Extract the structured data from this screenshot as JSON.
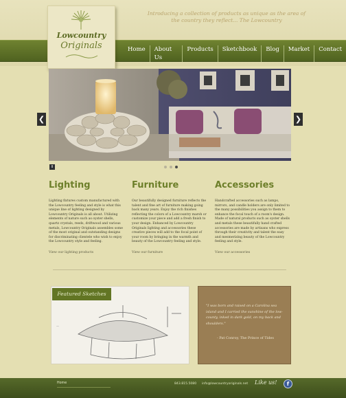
{
  "header": {
    "tagline": "Introducing a collection of products as unique as the area of the country they reflect... The Lowcountry",
    "logo_line1": "Lowcountry",
    "logo_line2": "Originals"
  },
  "nav": {
    "items": [
      "Home",
      "About Us",
      "Products",
      "Sketchbook",
      "Blog",
      "Market",
      "Contact"
    ]
  },
  "slideshow": {
    "prev_label": "❮",
    "next_label": "❯",
    "pause_label": "II",
    "dot_count": 3,
    "active_dot": 2
  },
  "columns": [
    {
      "title": "Lighting",
      "body": "Lighting fixtures custom manufactured with the Lowcountry feeling and style is what this unique line of lighting designed by Lowcountry Originals is all about. Utilizing elements of nature such as oyster shells, quartz crystals, reeds, driftwood and various metals, Lowcountry Originals assembles some of the most original and outstanding designs for discriminating clientele who wish to enjoy the Lowcountry style and feeling.",
      "link": "View our lighting products"
    },
    {
      "title": "Furniture",
      "body": "Our beautifully designed furniture reflects the talent and fine art of furniture making going back many years. Enjoy the rich finishes reflecting the colors of a Lowcountry marsh or customize your piece and add a fresh finish to your design. Enhanced by Lowcountry Originals lighting and accessories these creative pieces will add to the focal point of your room by bringing in the warmth and beauty of the Lowcountry feeling and style.",
      "link": "View our furniture"
    },
    {
      "title": "Accessories",
      "body": "Handcrafted accessories such as lamps, mirrors, and candle holders are only limited to the many possibilities you assign to them to enhance the focal touch of a room's design. Made of natural products such as oyster shells and metals these beautifully hand crafted accessories are made by artisans who express through their creativity and talent the easy and mesmerizing beauty of the Lowcountry feeling and style.",
      "link": "View our accessories"
    }
  ],
  "featured": {
    "ribbon_label": "Featured Sketches"
  },
  "quote": {
    "text": "\"I was born and raised on a Carolina sea island and I carried the sunshine of the low-county, inked in dark gold, on my back and shoulders.\"",
    "attribution": "- Pat Conroy, The Prince of Tides"
  },
  "footer": {
    "home_link": "Home",
    "phone": "843.815.5080",
    "email": "info@lowcountryoriginals.net",
    "like_label": "Like us!",
    "fb_label": "f"
  },
  "colors": {
    "nav_green": "#5b6d25",
    "title_green": "#6d7f2a",
    "quote_brown": "#9a7e54",
    "background": "#e4dfb2"
  }
}
